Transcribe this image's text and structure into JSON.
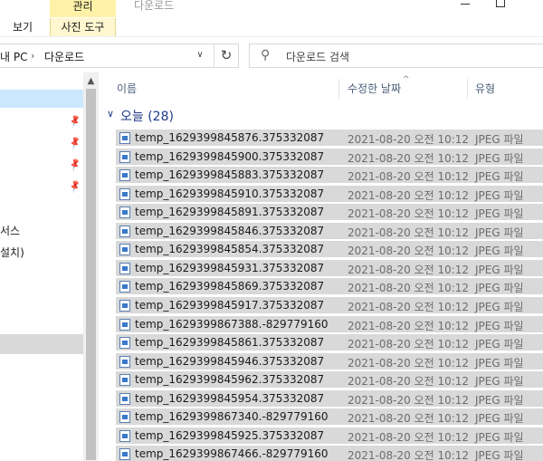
{
  "ribbon": {
    "manage_label": "관리",
    "window_title": "다운로드",
    "tab_view": "보기",
    "tab_photo_tools": "사진 도구"
  },
  "address": {
    "crumb_pc": "내 PC",
    "crumb_sep": "›",
    "crumb_downloads": "다운로드",
    "dropdown": "∨",
    "refresh": "↻"
  },
  "search": {
    "icon": "⚲",
    "placeholder": "다운로드 검색"
  },
  "nav": {
    "scroll_up": "▲",
    "items": [
      {
        "label": "",
        "pinned": true
      },
      {
        "label": "",
        "pinned": true
      },
      {
        "label": "",
        "pinned": true
      },
      {
        "label": "",
        "pinned": true
      },
      {
        "label": "서스"
      },
      {
        "label": "설치)"
      }
    ],
    "pin_glyph": "📌"
  },
  "columns": {
    "name": "이름",
    "date": "수정한 날짜",
    "type": "유형",
    "sort_caret": "^"
  },
  "group": {
    "chevron": "∨",
    "label": "오늘 (28)"
  },
  "files": [
    {
      "name": "temp_1629399845876.375332087",
      "date": "2021-08-20 오전 10:12",
      "type": "JPEG 파일"
    },
    {
      "name": "temp_1629399845900.375332087",
      "date": "2021-08-20 오전 10:12",
      "type": "JPEG 파일"
    },
    {
      "name": "temp_1629399845883.375332087",
      "date": "2021-08-20 오전 10:12",
      "type": "JPEG 파일"
    },
    {
      "name": "temp_1629399845910.375332087",
      "date": "2021-08-20 오전 10:12",
      "type": "JPEG 파일"
    },
    {
      "name": "temp_1629399845891.375332087",
      "date": "2021-08-20 오전 10:12",
      "type": "JPEG 파일"
    },
    {
      "name": "temp_1629399845846.375332087",
      "date": "2021-08-20 오전 10:12",
      "type": "JPEG 파일"
    },
    {
      "name": "temp_1629399845854.375332087",
      "date": "2021-08-20 오전 10:12",
      "type": "JPEG 파일"
    },
    {
      "name": "temp_1629399845931.375332087",
      "date": "2021-08-20 오전 10:12",
      "type": "JPEG 파일"
    },
    {
      "name": "temp_1629399845869.375332087",
      "date": "2021-08-20 오전 10:12",
      "type": "JPEG 파일"
    },
    {
      "name": "temp_1629399845917.375332087",
      "date": "2021-08-20 오전 10:12",
      "type": "JPEG 파일"
    },
    {
      "name": "temp_1629399867388.-829779160",
      "date": "2021-08-20 오전 10:12",
      "type": "JPEG 파일"
    },
    {
      "name": "temp_1629399845861.375332087",
      "date": "2021-08-20 오전 10:12",
      "type": "JPEG 파일"
    },
    {
      "name": "temp_1629399845946.375332087",
      "date": "2021-08-20 오전 10:12",
      "type": "JPEG 파일"
    },
    {
      "name": "temp_1629399845962.375332087",
      "date": "2021-08-20 오전 10:12",
      "type": "JPEG 파일"
    },
    {
      "name": "temp_1629399845954.375332087",
      "date": "2021-08-20 오전 10:12",
      "type": "JPEG 파일"
    },
    {
      "name": "temp_1629399867340.-829779160",
      "date": "2021-08-20 오전 10:12",
      "type": "JPEG 파일"
    },
    {
      "name": "temp_1629399845925.375332087",
      "date": "2021-08-20 오전 10:12",
      "type": "JPEG 파일"
    },
    {
      "name": "temp_1629399867466.-829779160",
      "date": "2021-08-20 오전 10:12",
      "type": "JPEG 파일"
    }
  ]
}
